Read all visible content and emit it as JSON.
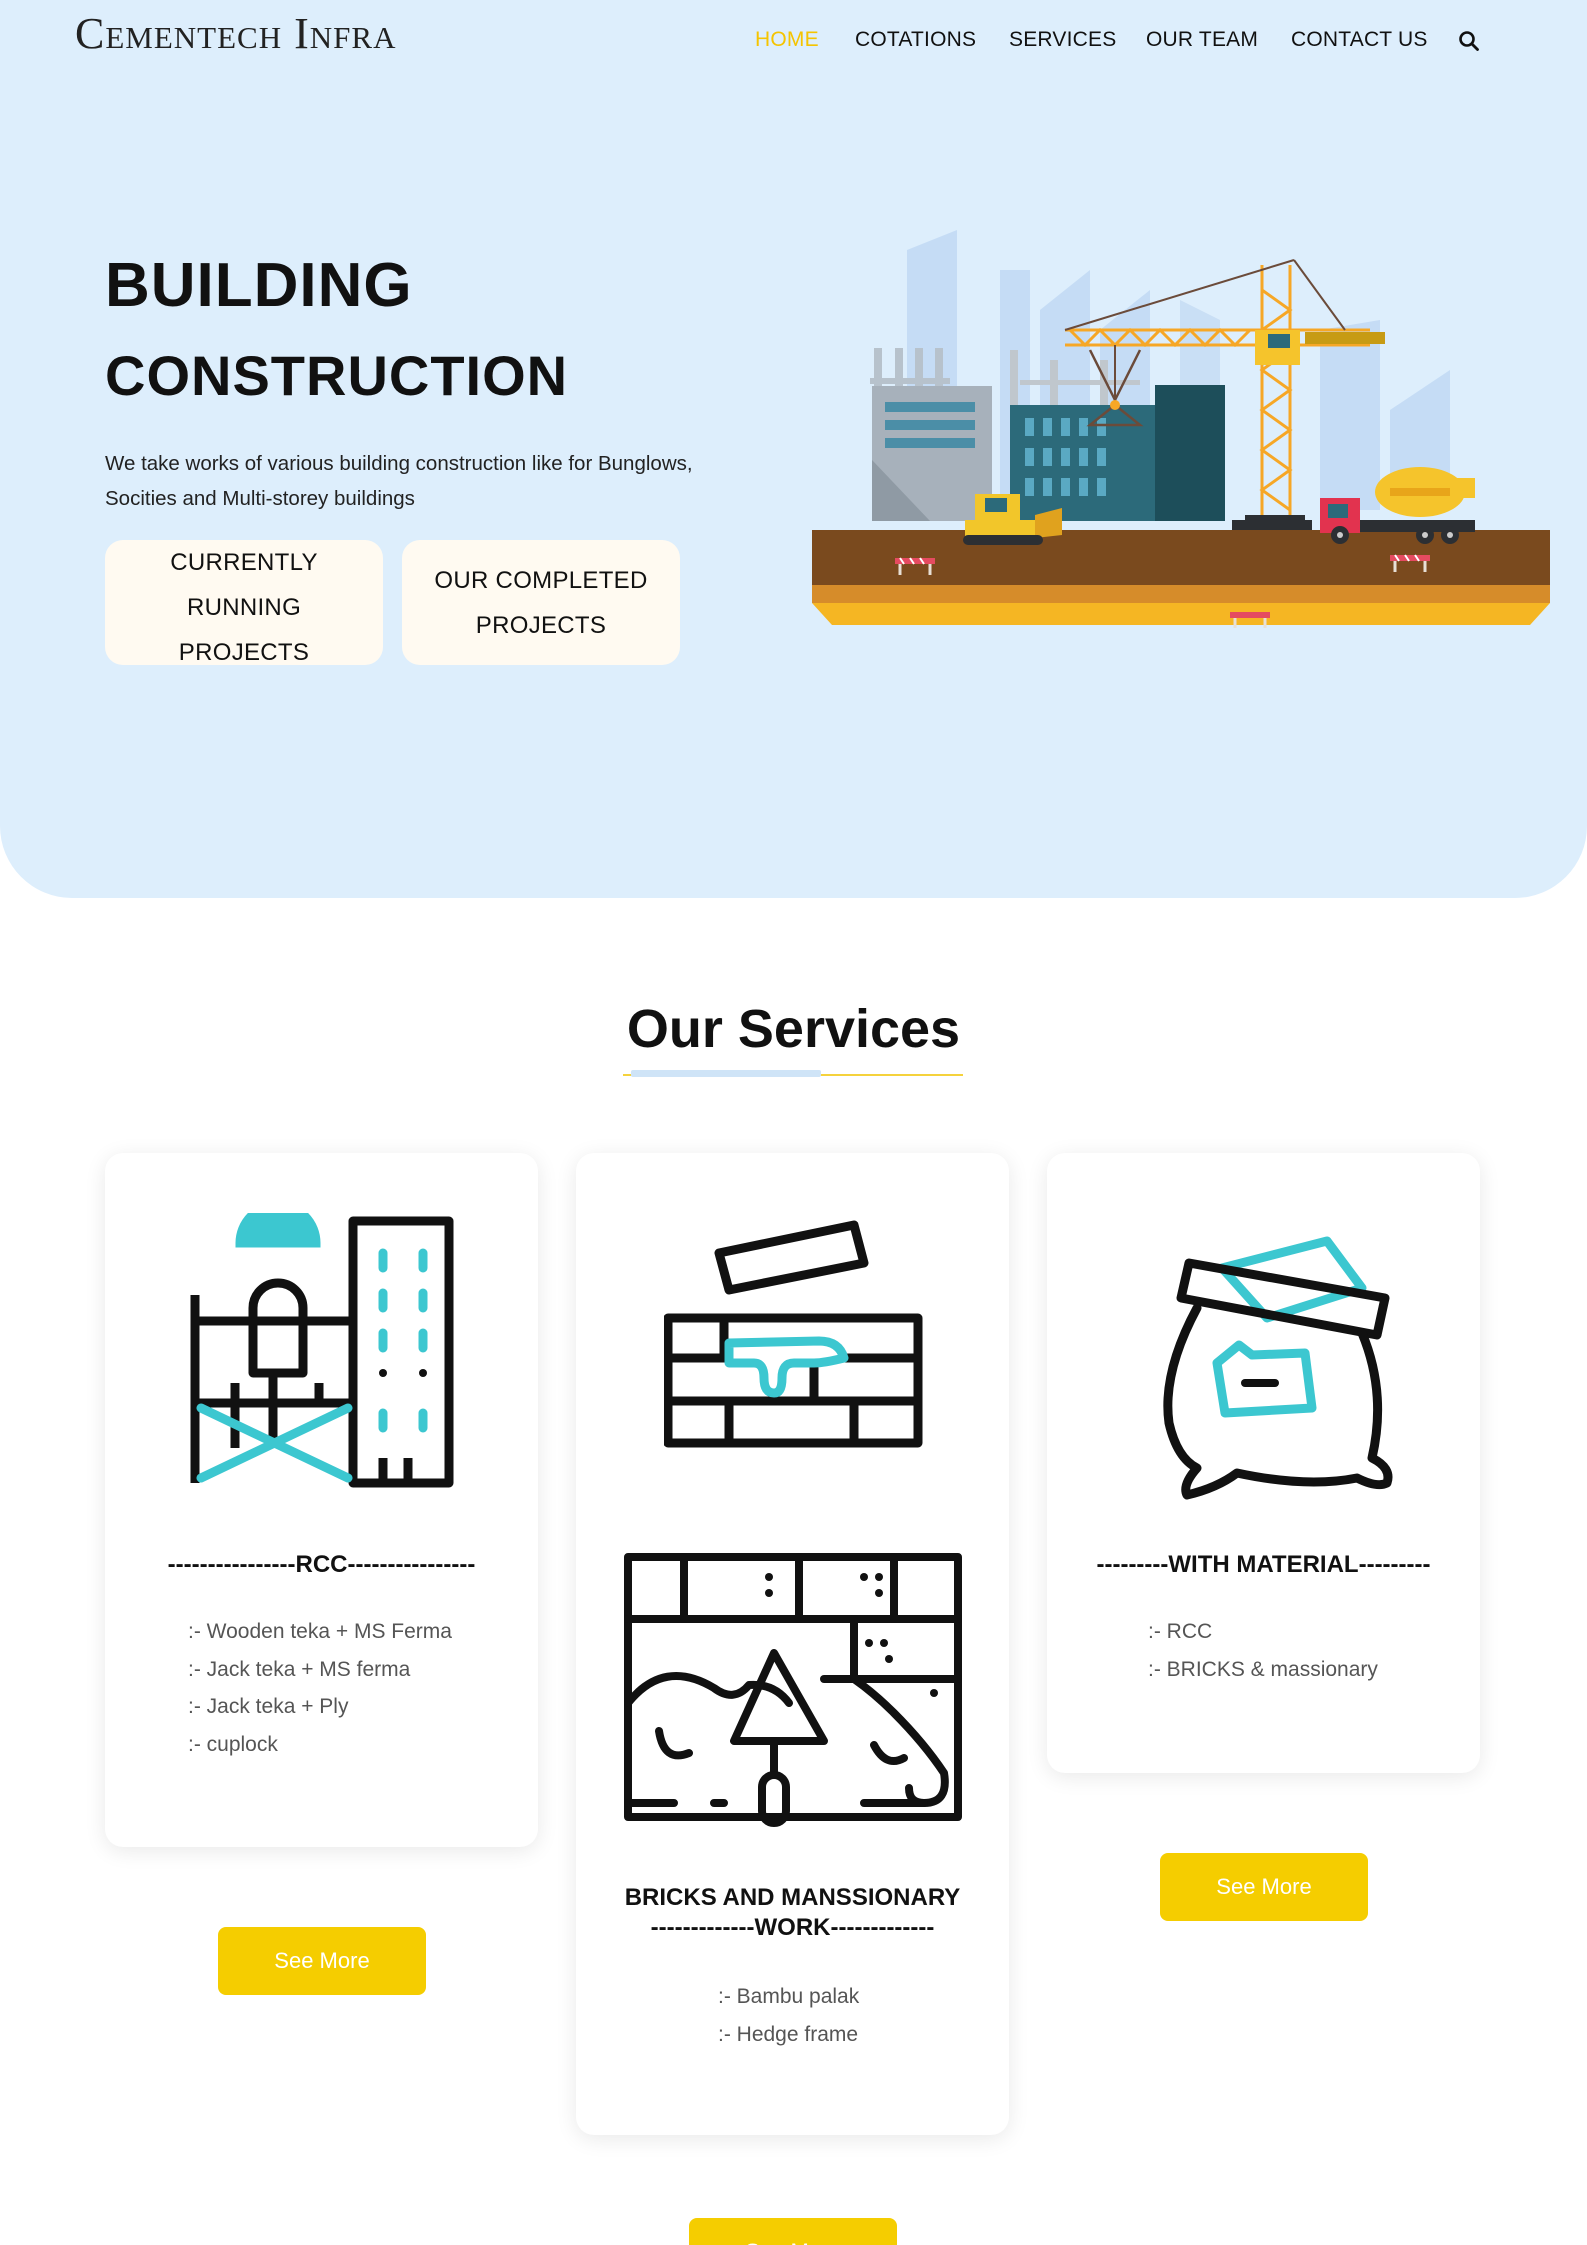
{
  "brand": {
    "name": "Cementech Infra"
  },
  "nav": {
    "items": [
      {
        "label": "HOME",
        "active": true
      },
      {
        "label": "COTATIONS",
        "active": false
      },
      {
        "label": "SERVICES",
        "active": false
      },
      {
        "label": "OUR TEAM",
        "active": false
      },
      {
        "label": "CONTACT US",
        "active": false
      }
    ],
    "search_icon": "search-icon"
  },
  "hero": {
    "title_line1": "BUILDING",
    "title_line2": "CONSTRUCTION",
    "description": "We take works of various building construction like for Bunglows, Socities and Multi-storey buildings",
    "buttons": [
      {
        "line1": "CURRENTLY RUNNING",
        "line2": "PROJECTS"
      },
      {
        "line1": "OUR COMPLETED",
        "line2": "PROJECTS"
      }
    ]
  },
  "services": {
    "title": "Our Services",
    "cards": [
      {
        "icon": "worker-scaffolding-icon",
        "heading": "----------------RCC----------------",
        "items": [
          ":- Wooden teka + MS Ferma",
          ":- Jack teka + MS ferma",
          ":- Jack teka + Ply",
          ":- cuplock"
        ],
        "button": "See More"
      },
      {
        "icon": "bricks-icon",
        "icon2": "wall-trowel-icon",
        "heading_line1": "BRICKS AND MANSSIONARY",
        "heading_line2": "-------------WORK-------------",
        "items": [
          ":- Bambu palak",
          ":- Hedge frame"
        ],
        "button": "See More"
      },
      {
        "icon": "cement-bag-icon",
        "heading": "---------WITH MATERIAL---------",
        "items": [
          ":- RCC",
          ":- BRICKS & massionary"
        ],
        "button": "See More"
      }
    ]
  },
  "colors": {
    "hero_bg": "#ddeefc",
    "accent_yellow": "#f5cd00",
    "nav_active": "#f5c400",
    "icon_teal": "#3cc7d0"
  }
}
